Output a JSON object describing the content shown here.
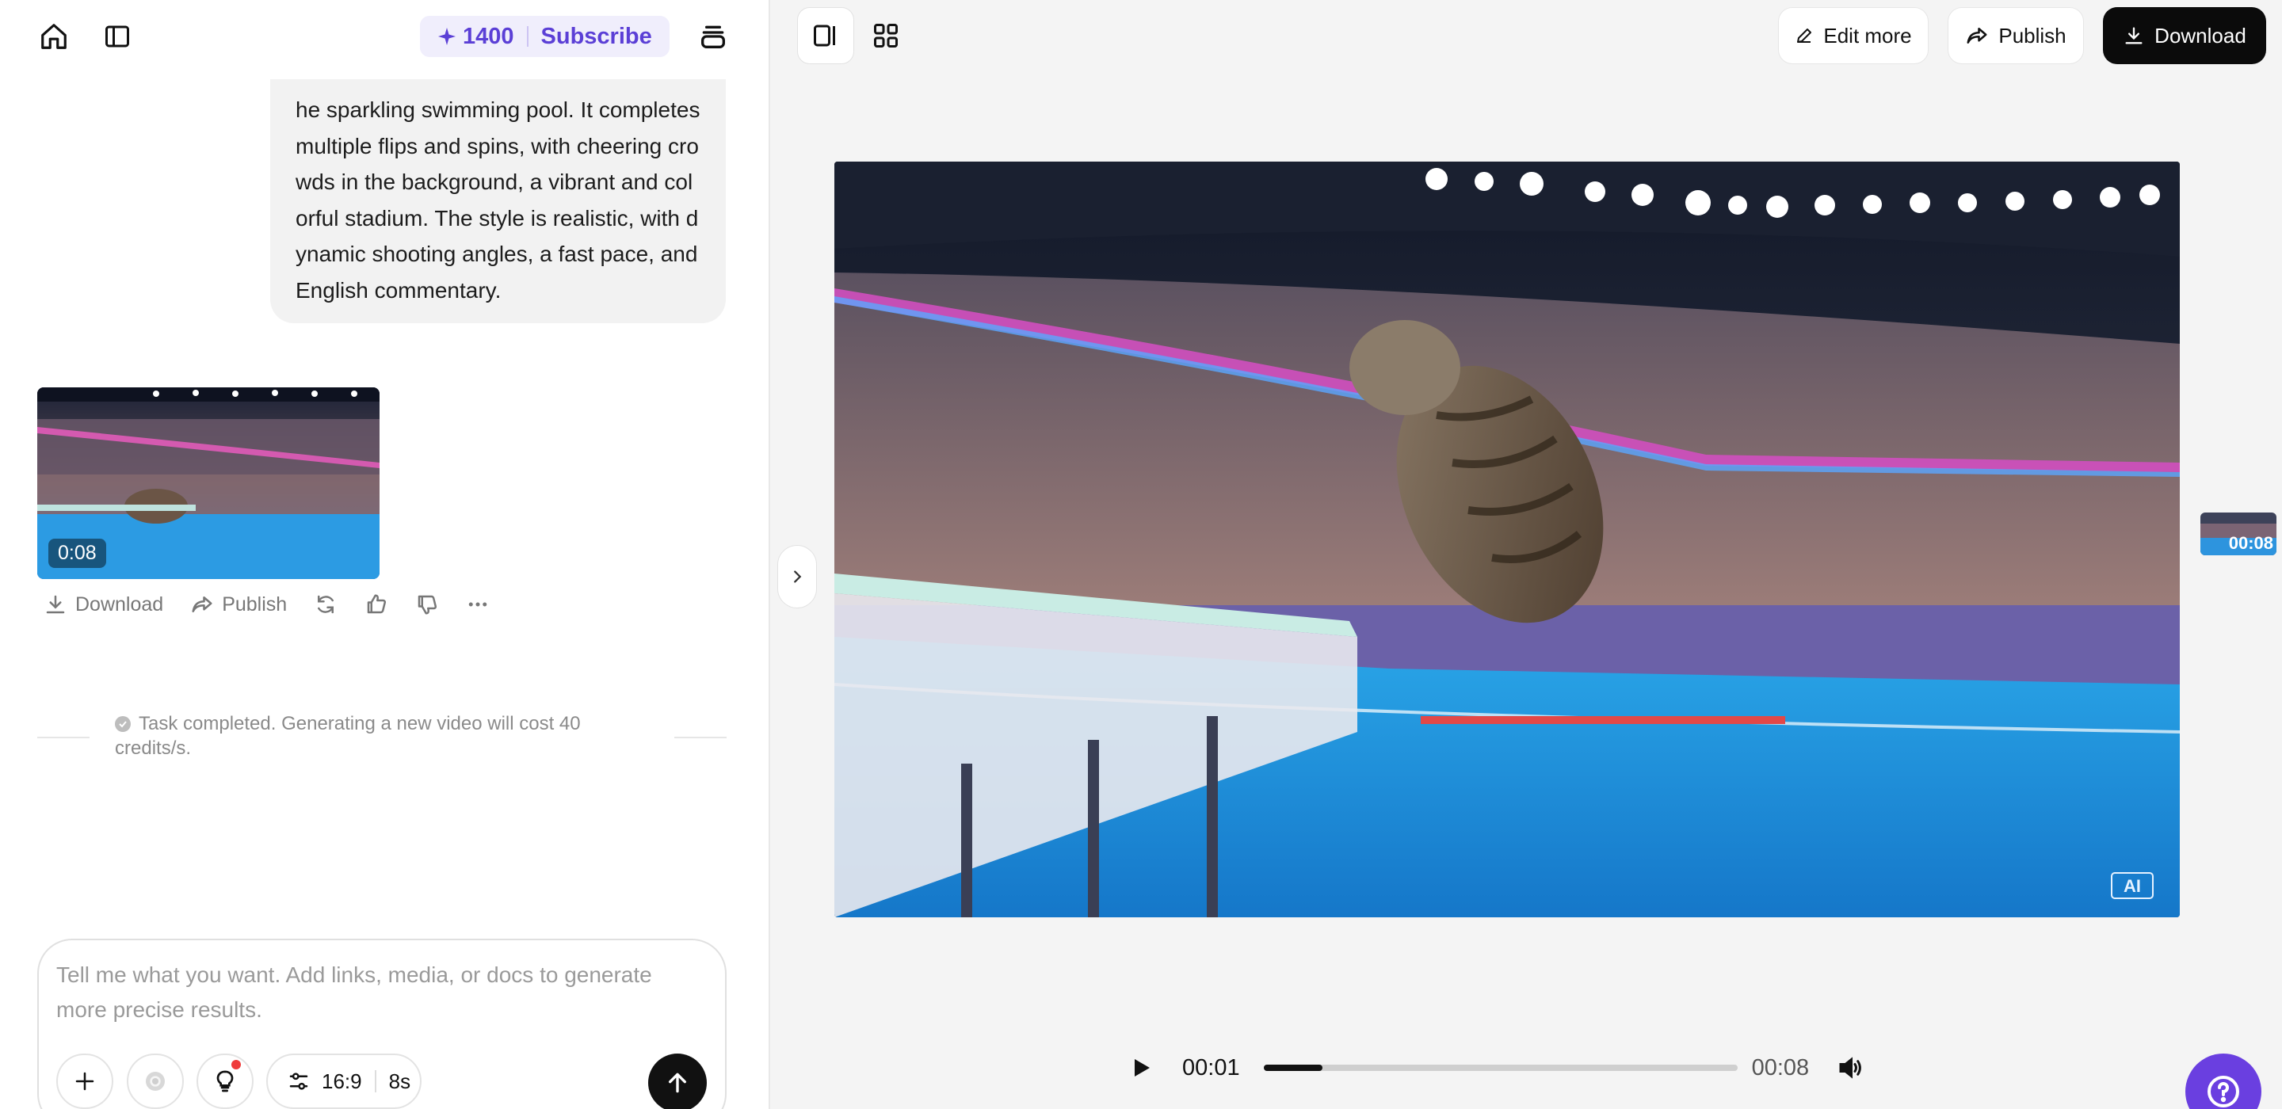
{
  "header": {
    "credits": "1400",
    "subscribe_label": "Subscribe"
  },
  "chat": {
    "prompt_text": "he sparkling swimming pool. It completes multiple flips and spins, with cheering crowds in the background, a vibrant and colorful stadium. The style is realistic, with dynamic shooting angles, a fast pace, and English commentary.",
    "video_duration": "0:08",
    "actions": {
      "download": "Download",
      "publish": "Publish"
    },
    "notice": "Task completed. Generating a new video will cost 40 credits/s."
  },
  "composer": {
    "placeholder": "Tell me what you want. Add links, media, or docs to generate more precise results.",
    "aspect_ratio": "16:9",
    "duration": "8s"
  },
  "toolbar": {
    "edit_more": "Edit more",
    "publish": "Publish",
    "download": "Download"
  },
  "player": {
    "current_time": "00:01",
    "total_time": "00:08",
    "progress": 0.125,
    "watermark": "AI",
    "side_thumb_time": "00:08"
  },
  "icons": [
    "home-icon",
    "sidebar-icon",
    "sparkle-icon",
    "stack-icon",
    "download-icon",
    "share-icon",
    "regenerate-icon",
    "thumbs-up-icon",
    "thumbs-down-icon",
    "more-icon",
    "check-icon",
    "plus-icon",
    "record-icon",
    "bulb-icon",
    "sliders-icon",
    "arrow-up-icon",
    "split-view-icon",
    "grid-icon",
    "pencil-icon",
    "chevron-right-icon",
    "play-icon",
    "volume-icon",
    "help-icon"
  ],
  "colors": {
    "accent": "#5b3fd6",
    "help": "#6a3fe0",
    "dark": "#0b0b0b"
  }
}
